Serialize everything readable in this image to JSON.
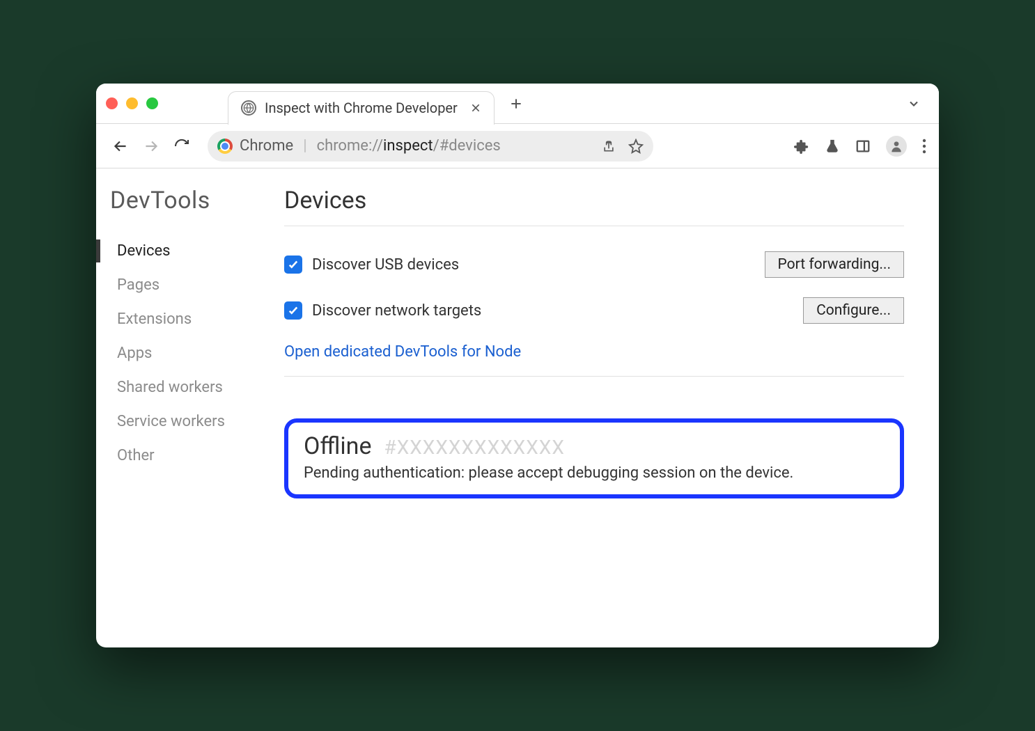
{
  "tab": {
    "title": "Inspect with Chrome Developer"
  },
  "omnibox": {
    "chip": "Chrome",
    "url_prefix": "chrome://",
    "url_emph": "inspect",
    "url_suffix": "/#devices"
  },
  "sidebar": {
    "brand": "DevTools",
    "items": [
      {
        "label": "Devices",
        "active": true
      },
      {
        "label": "Pages"
      },
      {
        "label": "Extensions"
      },
      {
        "label": "Apps"
      },
      {
        "label": "Shared workers"
      },
      {
        "label": "Service workers"
      },
      {
        "label": "Other"
      }
    ]
  },
  "main": {
    "title": "Devices",
    "discover_usb_label": "Discover USB devices",
    "port_forwarding_btn": "Port forwarding...",
    "discover_network_label": "Discover network targets",
    "configure_btn": "Configure...",
    "node_link": "Open dedicated DevTools for Node",
    "device": {
      "status": "Offline",
      "hash": "#XXXXXXXXXXXXX",
      "message": "Pending authentication: please accept debugging session on the device."
    }
  }
}
